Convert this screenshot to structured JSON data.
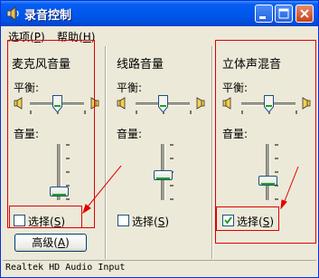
{
  "window": {
    "title": "录音控制",
    "title_bar_buttons": [
      "minimize-icon",
      "maximize-icon",
      "close-icon"
    ]
  },
  "menu": {
    "options_label": "选项",
    "options_key": "P",
    "help_label": "帮助",
    "help_key": "H"
  },
  "balance_label": "平衡:",
  "volume_label": "音量:",
  "select_label": "选择",
  "select_key": "S",
  "columns": [
    {
      "title": "麦克风音量",
      "selected": false,
      "balance": 0.5,
      "volume": 0.15
    },
    {
      "title": "线路音量",
      "selected": false,
      "balance": 0.5,
      "volume": 0.45
    },
    {
      "title": "立体声混音",
      "selected": true,
      "balance": 0.5,
      "volume": 0.35
    }
  ],
  "advanced_button": {
    "label": "高级",
    "key": "A"
  },
  "status": "Realtek HD Audio Input",
  "colors": {
    "title_bar": "#0058ee",
    "annotation_red": "#e00000",
    "checkmark_green": "#21a121"
  }
}
